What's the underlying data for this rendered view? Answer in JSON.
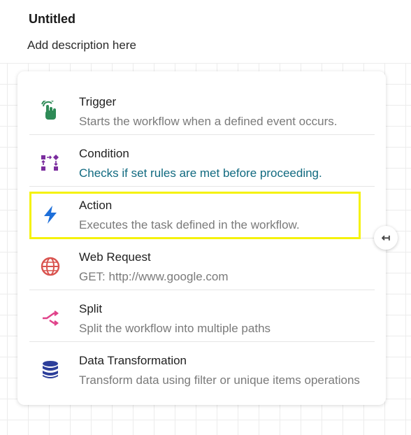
{
  "workflow": {
    "title": "Untitled",
    "description": "Add description here"
  },
  "nodes": [
    {
      "label": "Trigger",
      "description": "Starts the workflow when a defined event occurs.",
      "icon": "hand-touch-icon",
      "color": "#2e8b57"
    },
    {
      "label": "Condition",
      "description": "Checks if set rules are met before proceeding.",
      "icon": "condition-flow-icon",
      "color": "#7b2d9e"
    },
    {
      "label": "Action",
      "description": "Executes the task defined in the workflow.",
      "icon": "lightning-icon",
      "color": "#1e6fd9"
    },
    {
      "label": "Web Request",
      "description": "GET: http://www.google.com",
      "icon": "globe-icon",
      "color": "#d9534f"
    },
    {
      "label": "Split",
      "description": "Split the workflow into multiple paths",
      "icon": "split-arrow-icon",
      "color": "#e0428a"
    },
    {
      "label": "Data Transformation",
      "description": "Transform data using filter or unique items operations",
      "icon": "database-icon",
      "color": "#2c3e9a"
    }
  ],
  "collapse_button": {
    "icon": "collapse-arrow-icon",
    "glyph": "↤"
  }
}
